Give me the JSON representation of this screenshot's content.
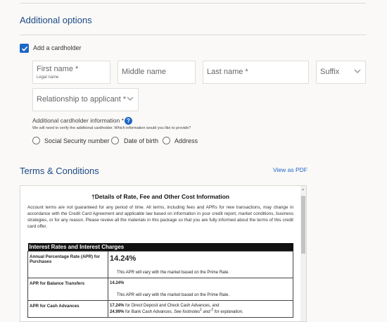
{
  "additional_options": {
    "title": "Additional options",
    "add_cardholder_label": "Add a cardholder",
    "add_cardholder_checked": true,
    "fields": {
      "first_name": {
        "placeholder": "First name *",
        "sublabel": "Legal name"
      },
      "middle_name": {
        "placeholder": "Middle name"
      },
      "last_name": {
        "placeholder": "Last name *"
      },
      "suffix": {
        "placeholder": "Suffix"
      },
      "relationship": {
        "placeholder": "Relationship to applicant *"
      }
    },
    "info_label": "Additional cardholder information *",
    "info_help_icon": "question-circle-icon",
    "info_sub": "We will need to verify the additional cardholder. Which information would you like to provide?",
    "radio_options": [
      "Social Security number",
      "Date of birth",
      "Address"
    ]
  },
  "terms": {
    "title": "Terms & Conditions",
    "pdf_link": "View as PDF",
    "doc_title": "†Details of Rate, Fee and Other Cost Information",
    "doc_paragraph": "Account terms are not guaranteed for any period of time. All terms, including fees and APRs for new transactions, may change in accordance with the Credit Card Agreement and applicable law based on information in your credit report, market conditions, business strategies, or for any reason. Please review all the materials in this package so that you are fully informed about the terms of this credit card offer.",
    "table": {
      "header": "Interest Rates and Interest Charges",
      "rows": [
        {
          "label": "Annual Percentage Rate (APR) for Purchases",
          "rate": "14.24%",
          "note": "This APR will vary with the market based on the Prime Rate."
        },
        {
          "label": "APR for Balance Transfers",
          "rate": "14.24%",
          "note": "This APR will vary with the market based on the Prime Rate."
        },
        {
          "label": "APR for Cash Advances",
          "line1_rate": "17.24%",
          "line1_text": " for Direct Deposit and Check Cash Advances, and",
          "line2_rate": "24.99%",
          "line2_text": " for Bank Cash Advances. ",
          "line2_italic": "See footnotes",
          "fn1": "1",
          "and": " and ",
          "fn2": "2",
          "line2_end": " for explanation."
        }
      ]
    }
  },
  "colors": {
    "accent": "#1e66c6",
    "heading": "#1b4a86",
    "background": "#faf9f7"
  }
}
